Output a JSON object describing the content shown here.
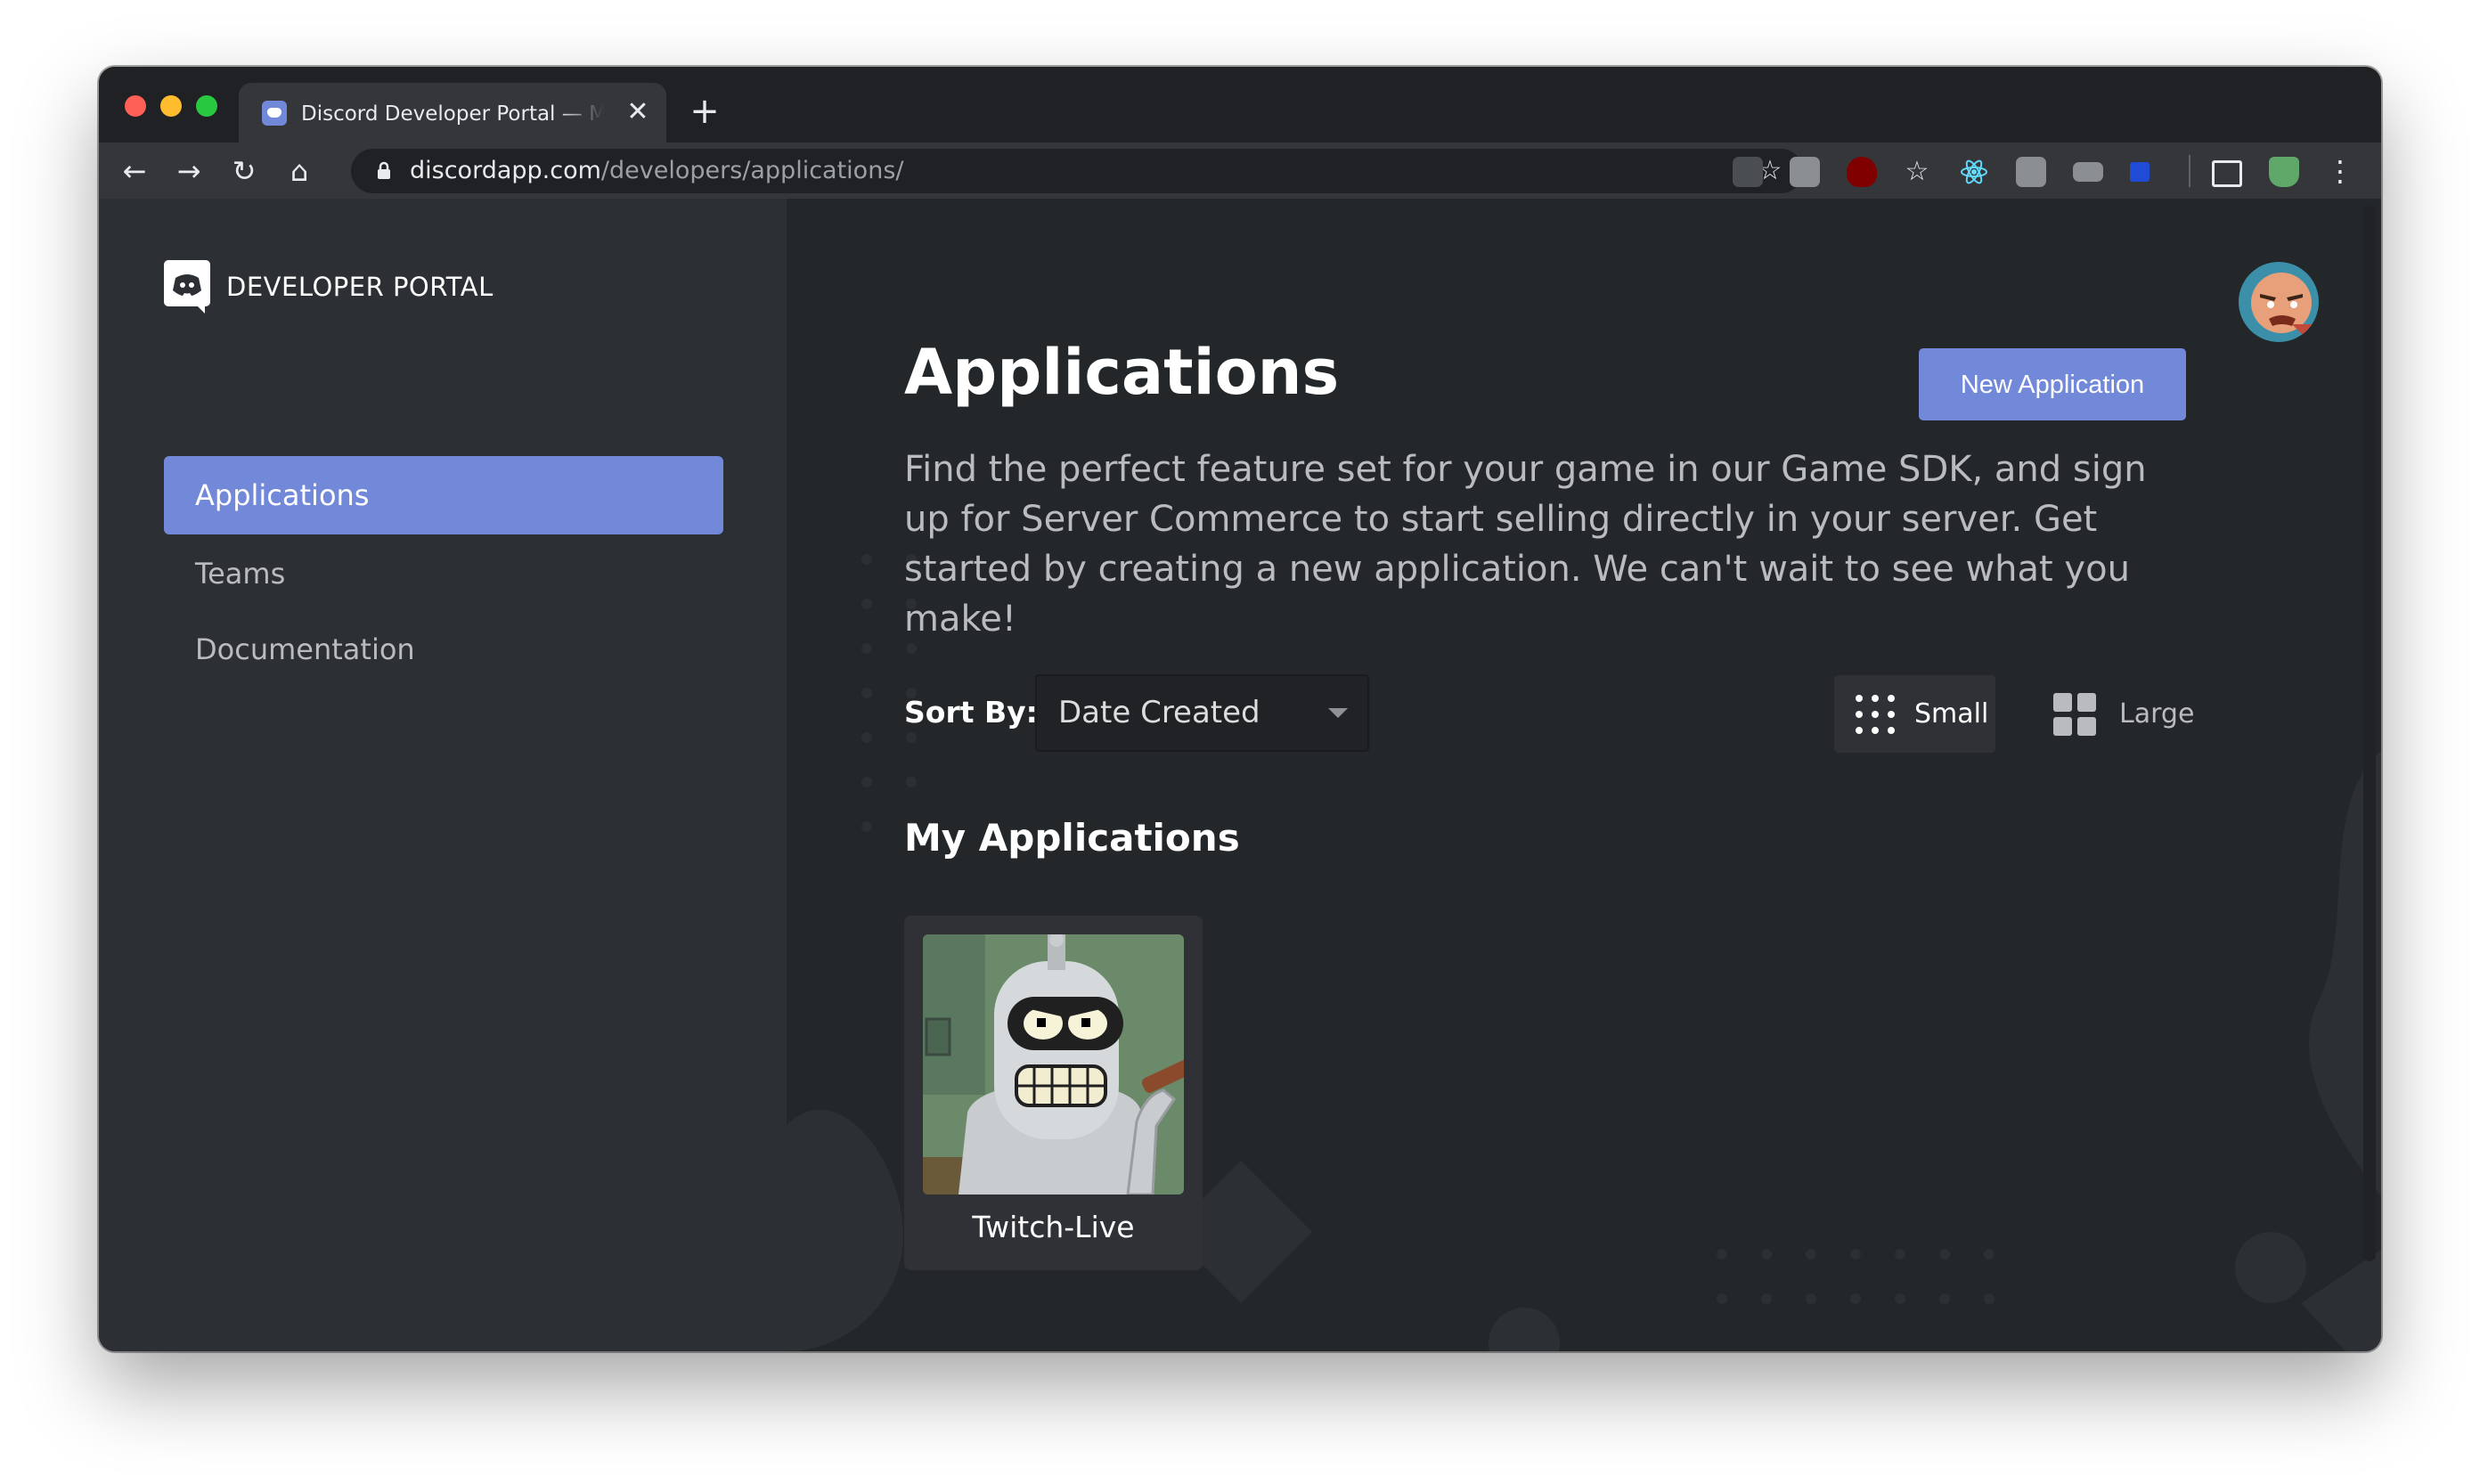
{
  "browser": {
    "tab_title": "Discord Developer Portal — My Applications",
    "tab_close": "✕",
    "new_tab": "+",
    "url_host": "discordapp.com",
    "url_path": "/developers/applications/",
    "nav": {
      "back": "←",
      "forward": "→",
      "reload": "↻",
      "home": "⌂"
    },
    "bookmark_icon": "☆",
    "menu_icon": "⋮"
  },
  "sidebar": {
    "brand": "DEVELOPER PORTAL",
    "items": [
      {
        "label": "Applications",
        "active": true
      },
      {
        "label": "Teams",
        "active": false
      },
      {
        "label": "Documentation",
        "active": false
      }
    ]
  },
  "main": {
    "title": "Applications",
    "new_app_button": "New Application",
    "description": "Find the perfect feature set for your game in our Game SDK, and sign up for Server Commerce to start selling directly in your server. Get started by creating a new application. We can't wait to see what you make!",
    "sort_label": "Sort By:",
    "sort_value": "Date Created",
    "view_small": "Small",
    "view_large": "Large",
    "section_title": "My Applications",
    "applications": [
      {
        "name": "Twitch-Live"
      }
    ]
  },
  "colors": {
    "blurple": "#7289da",
    "sidebar_bg": "#2c2f33",
    "main_bg": "#23272a",
    "card_bg": "#2f3136"
  }
}
